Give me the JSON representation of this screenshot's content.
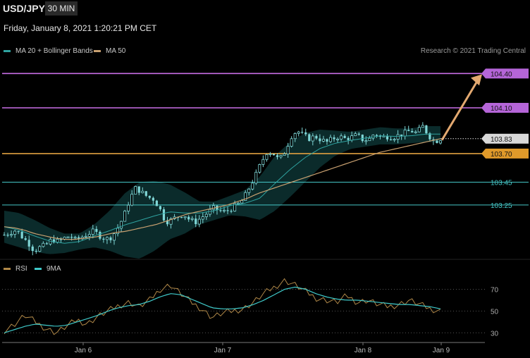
{
  "header": {
    "symbol": "USD/JPY",
    "timeframe": "30 MIN",
    "datetime": "Friday, January 8, 2021 1:20:21 PM CET",
    "credit": "Research © 2021 Trading Central"
  },
  "legend": {
    "ma20_bb": "MA 20 + Bollinger Bands",
    "ma50": "MA 50",
    "rsi": "RSI",
    "rsi_ma": "9MA"
  },
  "colors": {
    "candle": "#7fd6d6",
    "bb_fill": "#0f3a3a",
    "ma20": "#2fa3a0",
    "ma50": "#c8a070",
    "resistance": "#c86ee6",
    "support": "#e0a040",
    "target": "#45c7c7",
    "arrow": "#e3a970",
    "rsi": "#b08848",
    "rsi_ma": "#3fc9c9"
  },
  "chart_data": [
    {
      "type": "candlestick",
      "x_ticks": [
        "Jan 6",
        "Jan 7",
        "Jan 8",
        "Jan 9"
      ],
      "ylim": [
        102.75,
        104.55
      ],
      "current_price": 103.83,
      "levels": [
        {
          "value": 104.4,
          "label": "104.40",
          "kind": "resistance"
        },
        {
          "value": 104.1,
          "label": "104.10",
          "kind": "resistance"
        },
        {
          "value": 103.7,
          "label": "103.70",
          "kind": "support"
        },
        {
          "value": 103.45,
          "label": "103.45",
          "kind": "target"
        },
        {
          "value": 103.25,
          "label": "103.25",
          "kind": "target"
        }
      ],
      "close_path": [
        102.99,
        103.01,
        103.03,
        102.97,
        102.92,
        102.85,
        102.88,
        102.9,
        102.95,
        102.93,
        102.96,
        102.98,
        102.94,
        102.97,
        103.0,
        103.02,
        102.98,
        102.95,
        102.97,
        103.05,
        103.15,
        103.3,
        103.4,
        103.36,
        103.32,
        103.3,
        103.22,
        103.1,
        103.12,
        103.15,
        103.17,
        103.12,
        103.1,
        103.14,
        103.18,
        103.22,
        103.2,
        103.19,
        103.22,
        103.25,
        103.3,
        103.4,
        103.5,
        103.62,
        103.72,
        103.7,
        103.64,
        103.72,
        103.85,
        103.9,
        103.86,
        103.83,
        103.85,
        103.82,
        103.8,
        103.83,
        103.85,
        103.83,
        103.84,
        103.86,
        103.82,
        103.82,
        103.88,
        103.84,
        103.85,
        103.84,
        103.86,
        103.88,
        103.9,
        103.88,
        103.94,
        103.86,
        103.8,
        103.83
      ],
      "ma50_path": [
        103.06,
        103.05,
        103.03,
        103.0,
        102.98,
        102.96,
        102.95,
        102.95,
        102.96,
        102.97,
        102.99,
        103.01,
        103.02,
        103.04,
        103.06,
        103.08,
        103.11,
        103.14,
        103.17,
        103.19,
        103.21,
        103.23,
        103.25,
        103.28,
        103.31,
        103.35,
        103.38,
        103.41,
        103.44,
        103.47,
        103.5,
        103.53,
        103.56,
        103.59,
        103.62,
        103.65,
        103.68,
        103.71,
        103.73,
        103.75,
        103.77,
        103.79,
        103.81,
        103.83
      ],
      "bb_upper": [
        103.2,
        103.18,
        103.12,
        103.05,
        103.0,
        103.0,
        103.08,
        103.2,
        103.35,
        103.45,
        103.46,
        103.43,
        103.36,
        103.28,
        103.28,
        103.33,
        103.38,
        103.5,
        103.68,
        103.8,
        103.88,
        103.91,
        103.9,
        103.89,
        103.91,
        103.93,
        103.92,
        103.92,
        103.94,
        103.94
      ],
      "bb_lower": [
        102.92,
        102.88,
        102.84,
        102.82,
        102.83,
        102.86,
        102.88,
        102.85,
        102.8,
        102.78,
        102.85,
        102.95,
        103.0,
        103.08,
        103.12,
        103.16,
        103.15,
        103.12,
        103.2,
        103.32,
        103.45,
        103.58,
        103.68,
        103.74,
        103.76,
        103.78,
        103.78,
        103.79,
        103.8,
        103.8
      ]
    },
    {
      "type": "line",
      "name": "RSI",
      "yticks": [
        30,
        50,
        70
      ],
      "ylim": [
        25,
        80
      ],
      "rsi_path": [
        32,
        38,
        46,
        40,
        34,
        30,
        36,
        42,
        38,
        45,
        50,
        55,
        58,
        54,
        60,
        70,
        74,
        66,
        58,
        52,
        44,
        48,
        50,
        52,
        58,
        66,
        72,
        78,
        74,
        68,
        62,
        60,
        58,
        64,
        58,
        60,
        56,
        54,
        56,
        60,
        56,
        52,
        50
      ],
      "rsi_ma_path": [
        30,
        33,
        36,
        38,
        37,
        36,
        37,
        40,
        43,
        46,
        50,
        53,
        55,
        56,
        59,
        63,
        66,
        65,
        61,
        57,
        53,
        52,
        52,
        53,
        56,
        60,
        65,
        70,
        72,
        70,
        66,
        63,
        61,
        60,
        60,
        59,
        58,
        57,
        56,
        56,
        55,
        54,
        52
      ]
    }
  ]
}
